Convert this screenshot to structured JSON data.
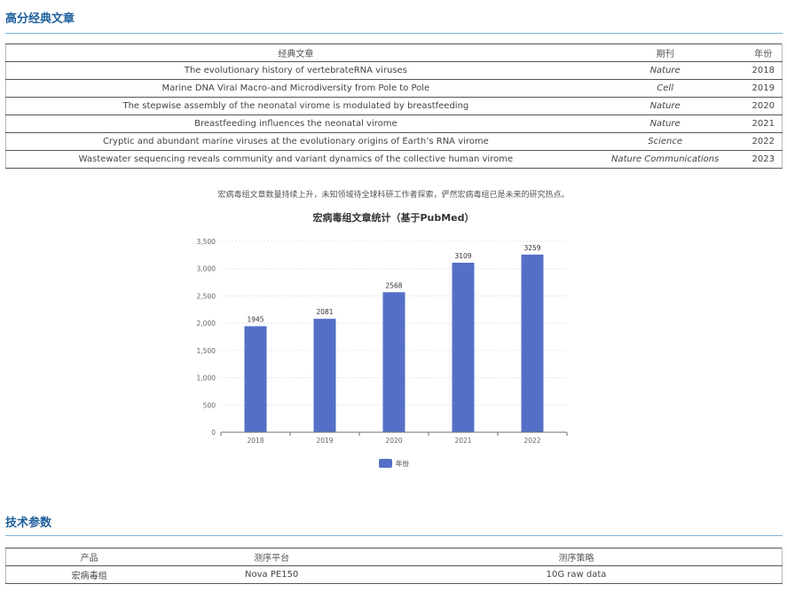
{
  "papers_section": {
    "title": "高分经典文章",
    "headers": [
      "经典文章",
      "期刊",
      "年份"
    ],
    "rows": [
      {
        "title": "The evolutionary history of vertebrateRNA viruses",
        "journal": "Nature",
        "year": "2018"
      },
      {
        "title": "Marine DNA Viral Macro-and Microdiversity from Pole to Pole",
        "journal": "Cell",
        "year": "2019"
      },
      {
        "title": "The stepwise assembly of the neonatal virome is modulated by breastfeeding",
        "journal": "Nature",
        "year": "2020"
      },
      {
        "title": "Breastfeeding influences the neonatal virome",
        "journal": "Nature",
        "year": "2021"
      },
      {
        "title": "Cryptic and abundant marine viruses at the evolutionary origins of Earth’s RNA virome",
        "journal": "Science",
        "year": "2022"
      },
      {
        "title": "Wastewater sequencing reveals community and variant dynamics of the collective human virome",
        "journal": "Nature Communications",
        "year": "2023"
      }
    ]
  },
  "intro_text": "宏病毒组文章数量持续上升，未知领域待全球科研工作者探索，俨然宏病毒组已是未来的研究热点。",
  "chart_data": {
    "type": "bar",
    "title": "宏病毒组文章统计（基于PubMed）",
    "categories": [
      "2018",
      "2019",
      "2020",
      "2021",
      "2022"
    ],
    "series": [
      {
        "name": "年份",
        "values": [
          1945,
          2081,
          2568,
          3109,
          3259
        ]
      }
    ],
    "ylim": [
      0,
      3500
    ],
    "yticks": [
      0,
      500,
      1000,
      1500,
      2000,
      2500,
      3000,
      3500
    ],
    "ytick_labels": [
      "0",
      "500",
      "1,000",
      "1,500",
      "2,000",
      "2,500",
      "3,000",
      "3,500"
    ],
    "grid": true,
    "legend": "bottom-center",
    "color": "#5470c6"
  },
  "tech_section": {
    "title": "技术参数",
    "headers": [
      "产品",
      "测序平台",
      "测序策略"
    ],
    "rows": [
      {
        "product": "宏病毒组",
        "platform": "Nova PE150",
        "strategy": "10G raw data"
      }
    ]
  }
}
